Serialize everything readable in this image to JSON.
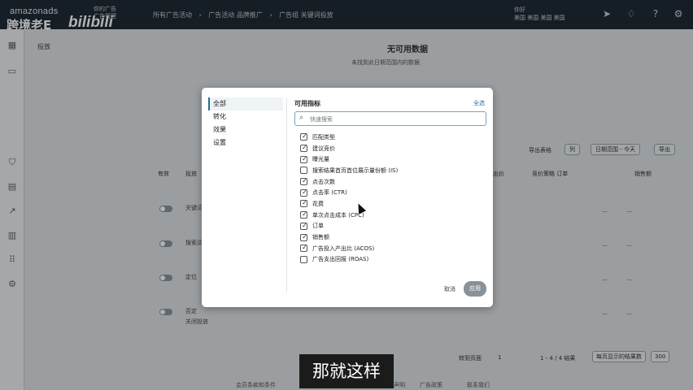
{
  "topbar": {
    "logo": "amazonads",
    "watermark": "跨境老E",
    "bili": "bilibili",
    "account_line1": "你的广告",
    "account_line2": "广告管理",
    "breadcrumbs": [
      "所有广告活动",
      "广告活动 品牌推广",
      "广告组 关键词投放"
    ],
    "right_text_line1": "你好",
    "right_text_line2": "美国 美国 美国 美国"
  },
  "page": {
    "tab": "投放",
    "nodata_title": "无可用数据",
    "nodata_subtitle": "未找到此日期范围内的数据",
    "export_label": "导出表格",
    "col_button": "列",
    "date_button": "日期范围 - 今天",
    "export_button": "导出",
    "columns": [
      "有效",
      "投放",
      "出价",
      "竞价策略 订单",
      "销售额"
    ],
    "row_labels": [
      "关键词",
      "搜索词",
      "定位",
      "否定"
    ],
    "row_sub": "关闭投放",
    "rows_dash": "—",
    "footer_goto": "转到页面",
    "footer_page": "1",
    "footer_range": "1 - 4 / 4 结果",
    "footer_perpage": "每页显示的结果数",
    "footer_perpage_value": "300",
    "bottom_links": [
      "会员条款和条件",
      "隐私声明",
      "广告政策",
      "联系我们"
    ]
  },
  "modal": {
    "nav": [
      "全部",
      "转化",
      "效果",
      "设置"
    ],
    "header": "可用指标",
    "select_all": "全选",
    "search_placeholder": "快速搜索",
    "metrics": [
      {
        "label": "匹配类型",
        "checked": true
      },
      {
        "label": "建议竞价",
        "checked": true
      },
      {
        "label": "曝光量",
        "checked": true
      },
      {
        "label": "搜索结果首页首位展示量份额 (IS)",
        "checked": false
      },
      {
        "label": "点击次数",
        "checked": true
      },
      {
        "label": "点击率 (CTR)",
        "checked": true
      },
      {
        "label": "花费",
        "checked": true
      },
      {
        "label": "单次点击成本 (CPC)",
        "checked": true
      },
      {
        "label": "订单",
        "checked": true
      },
      {
        "label": "销售额",
        "checked": true
      },
      {
        "label": "广告投入产出比 (ACOS)",
        "checked": true
      },
      {
        "label": "广告支出回报 (ROAS)",
        "checked": false
      }
    ],
    "cancel": "取消",
    "apply": "应用"
  },
  "subtitle": "那就这样"
}
